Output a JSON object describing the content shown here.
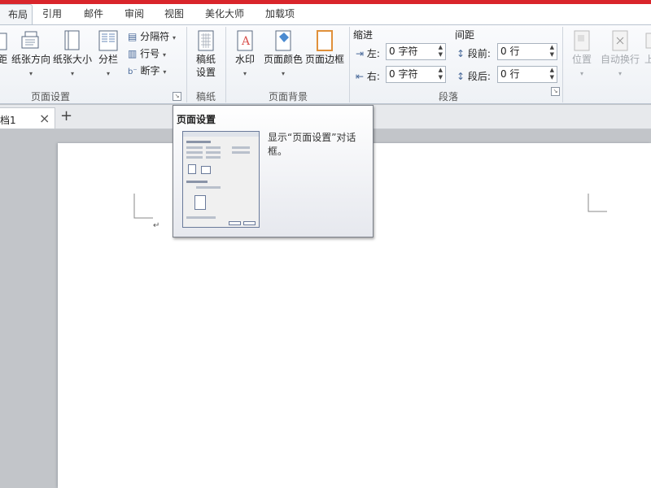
{
  "tabs": {
    "layout": "布局",
    "reference": "引用",
    "mail": "邮件",
    "review": "审阅",
    "view": "视图",
    "beautify": "美化大师",
    "addins": "加载项"
  },
  "ribbon": {
    "margins": "距",
    "orientation": "纸张方向",
    "size": "纸张大小",
    "columns": "分栏",
    "breaks": "分隔符",
    "line_numbers": "行号",
    "hyphenation": "断字",
    "page_setup_group": "页面设置",
    "manuscript_label_1": "稿纸",
    "manuscript_label_2": "设置",
    "manuscript_group": "稿纸",
    "watermark": "水印",
    "page_color": "页面颜色",
    "page_borders": "页面边框",
    "page_background_group": "页面背景",
    "indent_title": "缩进",
    "indent_left_label": "左:",
    "indent_left_value": "0 字符",
    "indent_right_label": "右:",
    "indent_right_value": "0 字符",
    "spacing_title": "间距",
    "spacing_before_label": "段前:",
    "spacing_before_value": "0 行",
    "spacing_after_label": "段后:",
    "spacing_after_value": "0 行",
    "paragraph_group": "段落",
    "position": "位置",
    "wrap_text": "自动换行",
    "bring_forward": "上"
  },
  "document_tab": {
    "name": "档1",
    "close": "×",
    "new": "+"
  },
  "tooltip": {
    "title": "页面设置",
    "description": "显示“页面设置”对话框。"
  },
  "colors": {
    "accent": "#d9252b"
  }
}
